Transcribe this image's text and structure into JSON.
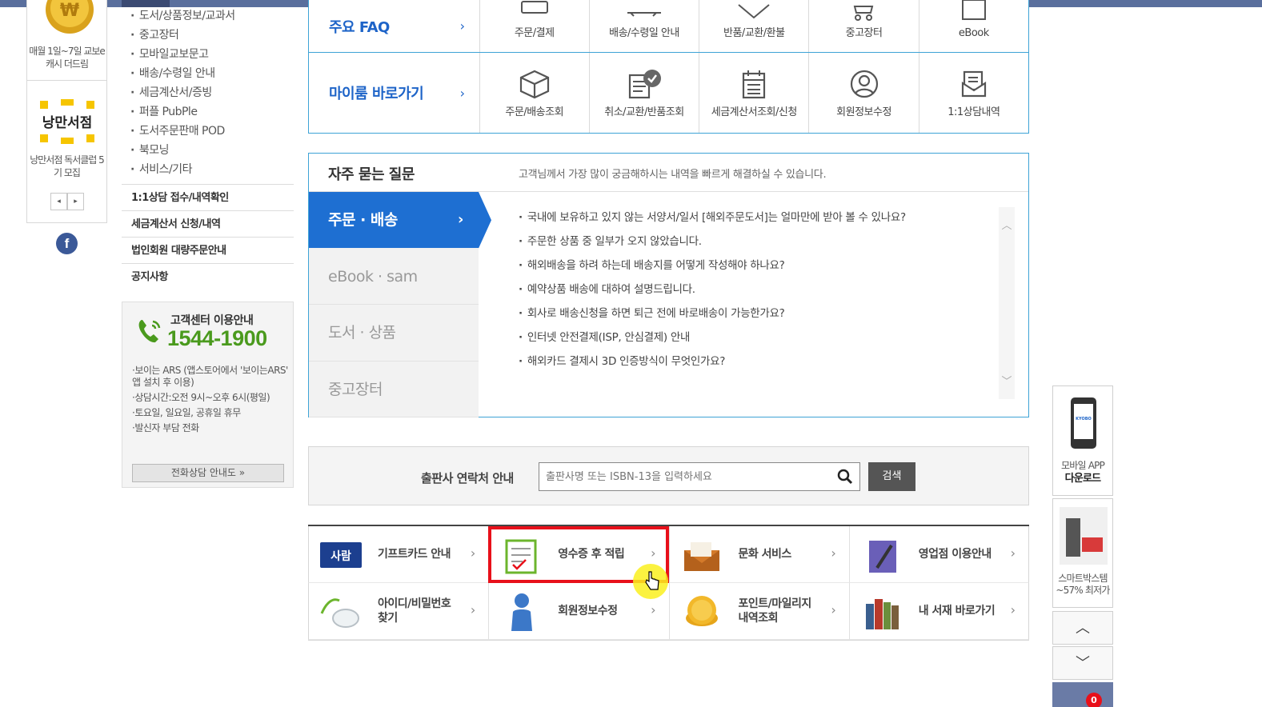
{
  "left_banners": {
    "banner1_text": "매월 1일~7일 교보e캐시 더드림",
    "banner2_text": "낭만서점 독서클럽 5기 모집",
    "banner2_logo_text": "낭만서점",
    "pager_prev": "◂",
    "pager_next": "▸",
    "facebook_label": "f"
  },
  "subnav": {
    "items": [
      "도서/상품정보/교과서",
      "중고장터",
      "모바일교보문고",
      "배송/수령일 안내",
      "세금계산서/증빙",
      "퍼플 PubPle",
      "도서주문판매 POD",
      "북모닝",
      "서비스/기타"
    ]
  },
  "leftmenu": {
    "items": [
      "1:1상담 접수/내역확인",
      "세금계산서 신청/내역",
      "법인회원 대량주문안내",
      "공지사항"
    ]
  },
  "callcenter": {
    "title": "고객센터 이용안내",
    "number": "1544-1900",
    "notes": [
      "·보이는 ARS (앱스토어에서 '보이는ARS' 앱 설치 후 이용)",
      "·상담시간:오전 9시~오후 6시(평일)",
      "·토요일, 일요일, 공휴일 휴무",
      "·발신자 부담 전화"
    ],
    "button": "전화상담 안내도  »"
  },
  "shortcuts": {
    "row1_title": "주요 FAQ",
    "row1_items": [
      "주문/결제",
      "배송/수령일 안내",
      "반품/교환/환불",
      "중고장터",
      "eBook"
    ],
    "row2_title": "마이룸 바로가기",
    "row2_items": [
      "주문/배송조회",
      "취소/교환/반품조회",
      "세금계산서조회/신청",
      "회원정보수정",
      "1:1상담내역"
    ],
    "chevron": "›"
  },
  "faq": {
    "title": "자주 묻는 질문",
    "description": "고객님께서 가장 많이 궁금해하시는 내역을 빠르게 해결하실 수 있습니다.",
    "tabs": [
      "주문 · 배송",
      "eBook · sam",
      "도서 · 상품",
      "중고장터"
    ],
    "active_tab_chevron": "›",
    "questions": [
      "국내에 보유하고 있지 않는 서양서/일서 [해외주문도서]는 얼마만에 받아 볼 수 있나요?",
      "주문한 상품 중 일부가 오지 않았습니다.",
      "해외배송을 하려 하는데 배송지를 어떻게 작성해야 하나요?",
      "예약상품 배송에 대하여 설명드립니다.",
      "회사로 배송신청을 하면 퇴근 전에 바로배송이 가능한가요?",
      "인터넷 안전결제(ISP, 안심결제) 안내",
      "해외카드 결제시 3D 인증방식이 무엇인가요?"
    ],
    "scroll_up": "︿",
    "scroll_down": "﹀"
  },
  "publisher": {
    "label": "출판사 연락처 안내",
    "placeholder": "출판사명 또는 ISBN-13을 입력하세요",
    "button": "검색"
  },
  "services": {
    "items": [
      "기프트카드 안내",
      "영수증 후 적립",
      "문화 서비스",
      "영업점 이용안내",
      "아이디/비밀번호\n찾기",
      "회원정보수정",
      "포인트/마일리지\n내역조회",
      "내 서재 바로가기"
    ],
    "chevron": "›",
    "gift_card_logo": "사람"
  },
  "quickpanel": {
    "app_label1": "모바일 APP",
    "app_label2": "다운로드",
    "app_logo": "KYOBO",
    "smart_label1": "스마트박스템",
    "smart_label2": "~57% 최저가",
    "up": "︿",
    "down": "﹀",
    "cart_count": "0"
  }
}
